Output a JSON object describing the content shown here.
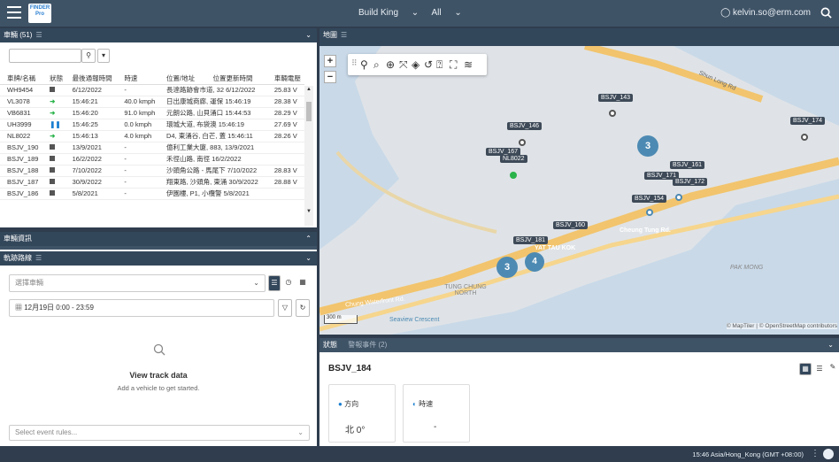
{
  "topbar": {
    "org": "Build King",
    "filter": "All",
    "user": "kelvin.so@erm.com",
    "logo_text": "FINDER Pro"
  },
  "vehicles": {
    "title": "車輛 (51)",
    "columns": [
      "車牌/名稱",
      "狀態",
      "最後通報時間",
      "時速",
      "位置/地址",
      "位置更新時間",
      "車輛電壓"
    ],
    "rows": [
      [
        "WH9454",
        "stop",
        "6/12/2022",
        "-",
        "長達路跡會市道, 32 6/12/2022",
        "",
        "25.83 V"
      ],
      [
        "VL3078",
        "go",
        "15:46:21",
        "40.0 kmph",
        "日出康城商廊, 運保 15:46:19",
        "",
        "28.38 V"
      ],
      [
        "VB6831",
        "go",
        "15:46:20",
        "91.0 kmph",
        "元朗公路, 山貝涌口 15:44:53",
        "",
        "28.29 V"
      ],
      [
        "UH3999",
        "pause",
        "15:46:25",
        "0.0 kmph",
        "環城大道, 布袋澳 15:46:19",
        "",
        "27.69 V"
      ],
      [
        "NL8022",
        "go",
        "15:46:13",
        "4.0 kmph",
        "D4, 東涌谷, 白芒, 蓋 15:46:11",
        "",
        "28.26 V"
      ],
      [
        "BSJV_190",
        "stop",
        "13/9/2021",
        "-",
        "億利工業大廈, 883, 13/9/2021",
        "",
        ""
      ],
      [
        "BSJV_189",
        "stop",
        "16/2/2022",
        "-",
        "禾徑山路, 南徑 16/2/2022",
        "",
        ""
      ],
      [
        "BSJV_188",
        "stop",
        "7/10/2022",
        "-",
        "沙頭角公路 - 馬尾下 7/10/2022",
        "",
        "28.83 V"
      ],
      [
        "BSJV_187",
        "stop",
        "30/9/2022",
        "-",
        "翔東路, 沙頭角, 東涌 30/9/2022",
        "",
        "28.88 V"
      ],
      [
        "BSJV_186",
        "stop",
        "5/8/2021",
        "-",
        "伊園樓, P1, 小欖警 5/8/2021",
        "",
        ""
      ]
    ]
  },
  "vehicle_info": {
    "title": "車輛資訊"
  },
  "track": {
    "title": "軌跡路線",
    "select_placeholder": "選擇車輛",
    "date_range": "12月19日 0:00 - 23:59",
    "empty_title": "View track data",
    "empty_sub": "Add a vehicle to get started.",
    "event_placeholder": "Select event rules..."
  },
  "map": {
    "title": "地圖",
    "attribution": "© MapTiler | © OpenStreetMap contributors",
    "scale": "300 m",
    "labels": [
      "BSJV_143",
      "BSJV_146",
      "BSJV_174",
      "BSJV_161",
      "BSJV_171",
      "BSJV_172",
      "BSJV_154",
      "BSJV_167",
      "NL8022",
      "BSJV_160",
      "BSJV_181"
    ],
    "clusters": [
      "3",
      "3",
      "4"
    ],
    "roads": [
      "Shun Long Rd",
      "Cheung Tung Rd.",
      "TUNG CHUNG NORTH",
      "PAK MONG",
      "Chung Waterfront Rd.",
      "Seaview Crescent",
      "YAT TAU KOK"
    ]
  },
  "detail": {
    "tab_status": "狀態",
    "tab_events": "警報事件 (2)",
    "vehicle": "BSJV_184",
    "cards": [
      {
        "label": "方向",
        "value": "北 0°"
      },
      {
        "label": "時速",
        "value": "-"
      }
    ]
  },
  "statusbar": {
    "timezone": "15:46 Asia/Hong_Kong (GMT +08:00)"
  }
}
